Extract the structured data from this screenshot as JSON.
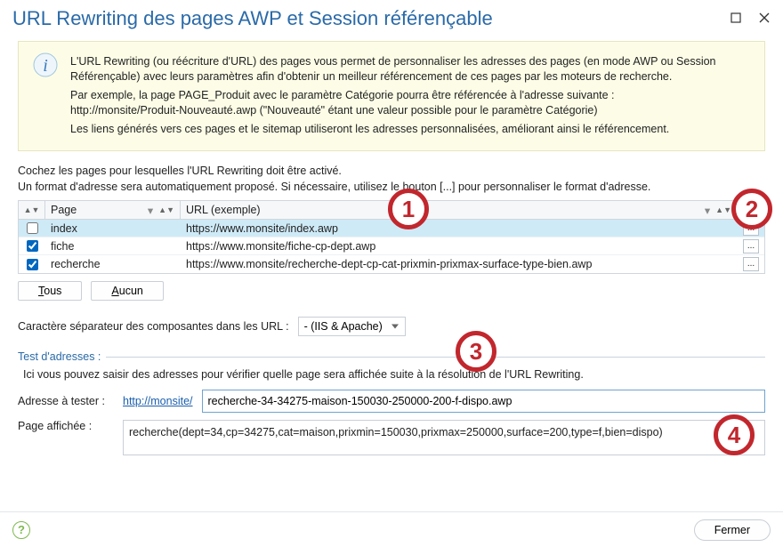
{
  "title": "URL Rewriting des pages AWP et Session référençable",
  "info": {
    "p1": "L'URL Rewriting (ou réécriture d'URL) des pages vous permet de personnaliser les adresses des pages (en mode AWP ou Session Référençable) avec leurs paramètres afin d'obtenir un meilleur référencement de ces pages par les moteurs de recherche.",
    "p2a": "Par exemple, la page PAGE_Produit avec le paramètre Catégorie pourra être référencée à l'adresse suivante :",
    "p2b": "http://monsite/Produit-Nouveauté.awp  (\"Nouveauté\" étant une valeur possible pour le paramètre Catégorie)",
    "p3": "Les liens générés vers ces pages et le sitemap utiliseront les adresses personnalisées, améliorant ainsi le référencement."
  },
  "instructions": {
    "line1": "Cochez les pages pour lesquelles l'URL Rewriting doit être activé.",
    "line2a": "Un format d'adresse sera automatiquement proposé. Si nécessaire, utilisez le bouton [...] pour personnaliser le format d'adresse."
  },
  "table": {
    "headers": {
      "page": "Page",
      "url": "URL (exemple)"
    },
    "rows": [
      {
        "checked": false,
        "page": "index",
        "url": "https://www.monsite/index.awp",
        "selected": true
      },
      {
        "checked": true,
        "page": "fiche",
        "url": "https://www.monsite/fiche-cp-dept.awp",
        "selected": false
      },
      {
        "checked": true,
        "page": "recherche",
        "url": "https://www.monsite/recherche-dept-cp-cat-prixmin-prixmax-surface-type-bien.awp",
        "selected": false
      }
    ]
  },
  "buttons": {
    "all_prefix": "T",
    "all_rest": "ous",
    "none_prefix": "A",
    "none_rest": "ucun",
    "close": "Fermer",
    "edit": "..."
  },
  "separator": {
    "label": "Caractère séparateur des composantes dans les URL :",
    "value": "- (IIS & Apache)"
  },
  "test": {
    "section": "Test d'adresses :",
    "desc": "Ici vous pouvez saisir des adresses pour vérifier quelle page sera affichée suite à la résolution de l'URL Rewriting.",
    "addr_label": "Adresse à tester :",
    "base_url": "http://monsite/",
    "addr_value": "recherche-34-34275-maison-150030-250000-200-f-dispo.awp",
    "page_label": "Page affichée :",
    "page_value": "recherche(dept=34,cp=34275,cat=maison,prixmin=150030,prixmax=250000,surface=200,type=f,bien=dispo)"
  },
  "callouts": {
    "c1": "1",
    "c2": "2",
    "c3": "3",
    "c4": "4"
  }
}
